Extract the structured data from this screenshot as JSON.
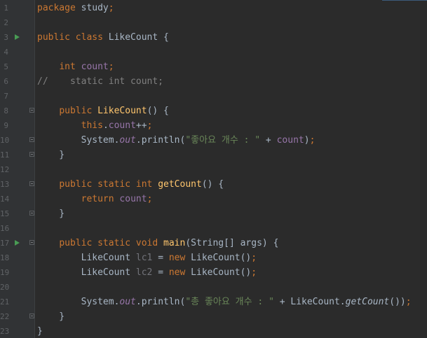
{
  "lines": [
    {
      "n": "1",
      "tokens": [
        {
          "t": "package",
          "c": "kw"
        },
        {
          "t": " study",
          "c": ""
        },
        {
          "t": ";",
          "c": "kw"
        }
      ]
    },
    {
      "n": "2",
      "tokens": []
    },
    {
      "n": "3",
      "run": true,
      "tokens": [
        {
          "t": "public class",
          "c": "kw"
        },
        {
          "t": " LikeCount {",
          "c": ""
        }
      ]
    },
    {
      "n": "4",
      "tokens": []
    },
    {
      "n": "5",
      "tokens": [
        {
          "t": "    ",
          "c": ""
        },
        {
          "t": "int",
          "c": "kw"
        },
        {
          "t": " ",
          "c": ""
        },
        {
          "t": "count",
          "c": "fld"
        },
        {
          "t": ";",
          "c": "kw"
        }
      ]
    },
    {
      "n": "6",
      "tokens": [
        {
          "t": "//    static int count;",
          "c": "cmt"
        }
      ]
    },
    {
      "n": "7",
      "tokens": []
    },
    {
      "n": "8",
      "fold": true,
      "tokens": [
        {
          "t": "    ",
          "c": ""
        },
        {
          "t": "public",
          "c": "kw"
        },
        {
          "t": " ",
          "c": ""
        },
        {
          "t": "LikeCount",
          "c": "mth"
        },
        {
          "t": "() {",
          "c": ""
        }
      ]
    },
    {
      "n": "9",
      "tokens": [
        {
          "t": "        ",
          "c": ""
        },
        {
          "t": "this",
          "c": "kw"
        },
        {
          "t": ".",
          "c": ""
        },
        {
          "t": "count",
          "c": "fld"
        },
        {
          "t": "++",
          "c": ""
        },
        {
          "t": ";",
          "c": "kw"
        }
      ]
    },
    {
      "n": "10",
      "fold": true,
      "tokens": [
        {
          "t": "        System.",
          "c": ""
        },
        {
          "t": "out",
          "c": "fld-i"
        },
        {
          "t": ".println(",
          "c": ""
        },
        {
          "t": "\"좋아요 개수 : \"",
          "c": "str"
        },
        {
          "t": " + ",
          "c": ""
        },
        {
          "t": "count",
          "c": "fld"
        },
        {
          "t": ")",
          "c": ""
        },
        {
          "t": ";",
          "c": "kw"
        }
      ]
    },
    {
      "n": "11",
      "fold": true,
      "tokens": [
        {
          "t": "    }",
          "c": ""
        }
      ]
    },
    {
      "n": "12",
      "tokens": []
    },
    {
      "n": "13",
      "fold": true,
      "tokens": [
        {
          "t": "    ",
          "c": ""
        },
        {
          "t": "public static int",
          "c": "kw"
        },
        {
          "t": " ",
          "c": ""
        },
        {
          "t": "getCount",
          "c": "mth"
        },
        {
          "t": "() {",
          "c": ""
        }
      ]
    },
    {
      "n": "14",
      "tokens": [
        {
          "t": "        ",
          "c": ""
        },
        {
          "t": "return",
          "c": "kw"
        },
        {
          "t": " ",
          "c": ""
        },
        {
          "t": "count",
          "c": "fld"
        },
        {
          "t": ";",
          "c": "kw"
        }
      ]
    },
    {
      "n": "15",
      "fold": true,
      "tokens": [
        {
          "t": "    }",
          "c": ""
        }
      ]
    },
    {
      "n": "16",
      "tokens": []
    },
    {
      "n": "17",
      "run": true,
      "fold": true,
      "tokens": [
        {
          "t": "    ",
          "c": ""
        },
        {
          "t": "public static void",
          "c": "kw"
        },
        {
          "t": " ",
          "c": ""
        },
        {
          "t": "main",
          "c": "mth"
        },
        {
          "t": "(String[] args) {",
          "c": ""
        }
      ]
    },
    {
      "n": "18",
      "tokens": [
        {
          "t": "        LikeCount ",
          "c": ""
        },
        {
          "t": "lc1",
          "c": "unused"
        },
        {
          "t": " = ",
          "c": ""
        },
        {
          "t": "new",
          "c": "kw"
        },
        {
          "t": " LikeCount()",
          "c": ""
        },
        {
          "t": ";",
          "c": "kw"
        }
      ]
    },
    {
      "n": "19",
      "tokens": [
        {
          "t": "        LikeCount ",
          "c": ""
        },
        {
          "t": "lc2",
          "c": "unused"
        },
        {
          "t": " = ",
          "c": ""
        },
        {
          "t": "new",
          "c": "kw"
        },
        {
          "t": " LikeCount()",
          "c": ""
        },
        {
          "t": ";",
          "c": "kw"
        }
      ]
    },
    {
      "n": "20",
      "tokens": []
    },
    {
      "n": "21",
      "tokens": [
        {
          "t": "        System.",
          "c": ""
        },
        {
          "t": "out",
          "c": "fld-i"
        },
        {
          "t": ".println(",
          "c": ""
        },
        {
          "t": "\"총 좋아요 개수 : \"",
          "c": "str"
        },
        {
          "t": " + LikeCount.",
          "c": ""
        },
        {
          "t": "getCount",
          "c": "call-i"
        },
        {
          "t": "())",
          "c": ""
        },
        {
          "t": ";",
          "c": "kw"
        }
      ]
    },
    {
      "n": "22",
      "fold": true,
      "tokens": [
        {
          "t": "    }",
          "c": ""
        }
      ]
    },
    {
      "n": "23",
      "tokens": [
        {
          "t": "}",
          "c": ""
        }
      ]
    }
  ]
}
